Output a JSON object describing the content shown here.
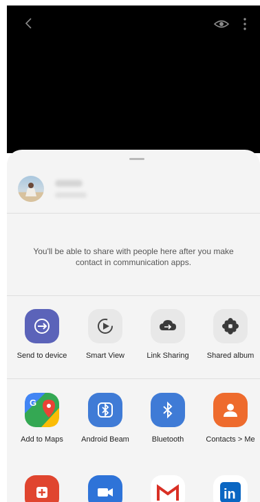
{
  "topbar": {
    "back_icon": "chevron-left-icon",
    "eye_icon": "eye-icon",
    "more_icon": "more-vertical-icon"
  },
  "sheet": {
    "info_text": "You'll be able to share with people here after you make contact in communication apps.",
    "row1": [
      {
        "label": "Send to device",
        "icon": "send-to-device-icon",
        "color": "#5b63b9"
      },
      {
        "label": "Smart View",
        "icon": "smart-view-icon",
        "color": "#e8e8e8"
      },
      {
        "label": "Link Sharing",
        "icon": "link-sharing-icon",
        "color": "#e8e8e8"
      },
      {
        "label": "Shared album",
        "icon": "shared-album-icon",
        "color": "#e8e8e8"
      }
    ],
    "row2": [
      {
        "label": "Add to Maps",
        "icon": "google-maps-icon",
        "color": "#ffffff"
      },
      {
        "label": "Android Beam",
        "icon": "android-beam-icon",
        "color": "#3f7bd6"
      },
      {
        "label": "Bluetooth",
        "icon": "bluetooth-icon",
        "color": "#3f7bd6"
      },
      {
        "label": "Contacts > Me",
        "icon": "contacts-icon",
        "color": "#ee6b2d"
      }
    ]
  }
}
